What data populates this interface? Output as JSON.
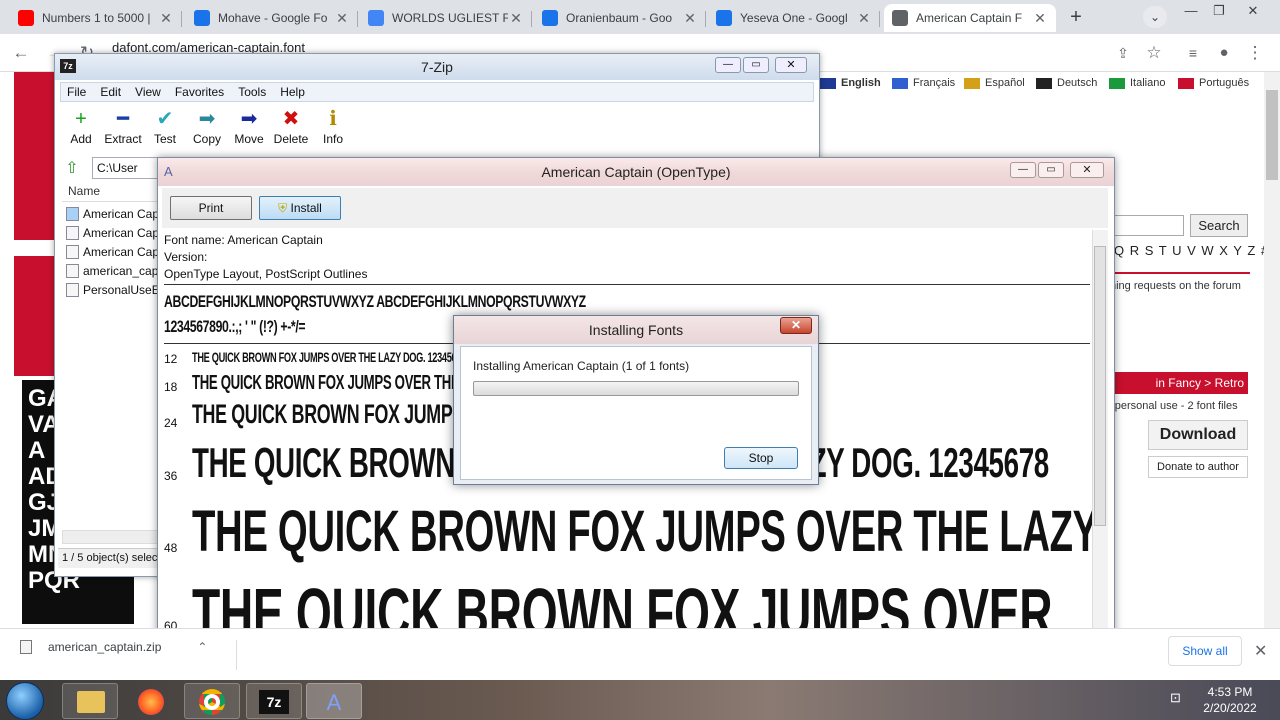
{
  "browser": {
    "tabs": [
      {
        "title": "Numbers 1 to 5000 |",
        "favicon_color": "#ff0000",
        "active": false
      },
      {
        "title": "Mohave - Google Fo",
        "favicon_color": "#1a73e8",
        "active": false
      },
      {
        "title": "WORLDS UGLIEST F(",
        "favicon_color": "#4285f4",
        "active": false
      },
      {
        "title": "Oranienbaum - Goo",
        "favicon_color": "#1a73e8",
        "active": false
      },
      {
        "title": "Yeseva One - Googl",
        "favicon_color": "#1a73e8",
        "active": false
      },
      {
        "title": "American Captain F",
        "favicon_color": "#5f6368",
        "active": true
      }
    ],
    "url": "dafont.com/american-captain.font"
  },
  "website": {
    "languages": [
      {
        "label": "English",
        "bold": true
      },
      {
        "label": "Français",
        "bold": false
      },
      {
        "label": "Español",
        "bold": false
      },
      {
        "label": "Deutsch",
        "bold": false
      },
      {
        "label": "Italiano",
        "bold": false
      },
      {
        "label": "Português",
        "bold": false
      }
    ],
    "search_button": "Search",
    "alphabet": "Q R S T U V W X Y Z #",
    "forum_text": "hing requests on the forum",
    "category": "in Fancy > Retro",
    "license_text": "r personal use - 2 font files",
    "download_button": "Download",
    "donate_button": "Donate to author",
    "left_letters": "GA\nVAI\nA\nAD\nGJ\nJM\nMNO\nPQR"
  },
  "zip": {
    "title": "7-Zip",
    "menu": [
      "File",
      "Edit",
      "View",
      "Favorites",
      "Tools",
      "Help"
    ],
    "tools": [
      {
        "label": "Add",
        "icon": "+",
        "color": "#1aa01a"
      },
      {
        "label": "Extract",
        "icon": "━",
        "color": "#1a3fa0"
      },
      {
        "label": "Test",
        "icon": "✔",
        "color": "#2aa8b8"
      },
      {
        "label": "Copy",
        "icon": "➡",
        "color": "#2a8a9a"
      },
      {
        "label": "Move",
        "icon": "➡",
        "color": "#1a2a9a"
      },
      {
        "label": "Delete",
        "icon": "✖",
        "color": "#d01010"
      },
      {
        "label": "Info",
        "icon": "ℹ",
        "color": "#b08a00"
      }
    ],
    "path": "C:\\User",
    "list_header": "Name",
    "files": [
      "American Capt",
      "American Capt",
      "American Capt",
      "american_cap",
      "PersonalUseEU"
    ],
    "status": "1 / 5 object(s) selected"
  },
  "font_viewer": {
    "title": "American Captain (OpenType)",
    "print_button": "Print",
    "install_button": "Install",
    "info_lines": [
      "Font name: American Captain",
      "Version:",
      "OpenType Layout, PostScript Outlines"
    ],
    "alphabet_preview": "ABCDEFGHIJKLMNOPQRSTUVWXYZ ABCDEFGHIJKLMNOPQRSTUVWXYZ",
    "numbers_preview": "1234567890.:,; ' \" (!?) +-*/=",
    "samples": [
      {
        "size": "12",
        "text": "THE QUICK BROWN FOX JUMPS OVER THE LAZY DOG. 1234567890"
      },
      {
        "size": "18",
        "text": "THE QUICK BROWN FOX JUMPS OVER THE LAZY DOG. 1234567890"
      },
      {
        "size": "24",
        "text": "THE QUICK BROWN FOX JUMPS OVER THE LAZY DOG. 1234567890"
      },
      {
        "size": "36",
        "text": "THE QUICK BROWN FOX JUMPS OVER THE LAZY DOG. 12345678"
      },
      {
        "size": "48",
        "text": "THE QUICK BROWN FOX JUMPS OVER THE LAZY"
      },
      {
        "size": "60",
        "text": "THE QUICK BROWN FOX JUMPS OVER"
      }
    ]
  },
  "install_dialog": {
    "title": "Installing Fonts",
    "message": "Installing American Captain (1 of 1 fonts)",
    "progress": 0.0,
    "stop_button": "Stop"
  },
  "download_shelf": {
    "file": "american_captain.zip",
    "show_all": "Show all"
  },
  "taskbar": {
    "time": "4:53 PM",
    "date": "2/20/2022"
  }
}
